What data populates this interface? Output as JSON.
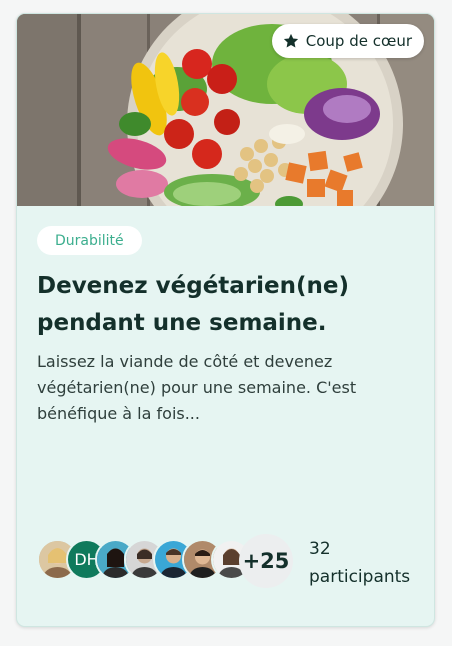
{
  "card": {
    "badge": {
      "icon": "star-icon",
      "label": "Coup de cœur"
    },
    "image": {
      "alt": "salad-bowl-image"
    },
    "tag": "Durabilité",
    "title": "Devenez végétarien(ne) pendant une semaine.",
    "description": "Laissez la viande de côté et devenez végétarien(ne) pour une semaine. C'est bénéfique à la fois...",
    "participants": {
      "avatars": [
        {
          "type": "photo"
        },
        {
          "type": "initials",
          "text": "DH"
        },
        {
          "type": "photo"
        },
        {
          "type": "photo"
        },
        {
          "type": "photo"
        },
        {
          "type": "photo"
        },
        {
          "type": "photo"
        }
      ],
      "more_count": "+25",
      "count": "32",
      "label": "participants"
    }
  },
  "colors": {
    "card_background": "#e6f5f2",
    "tag_text": "#3cae8e",
    "title_text": "#14302b",
    "initials_avatar": "#0f7a5c"
  }
}
